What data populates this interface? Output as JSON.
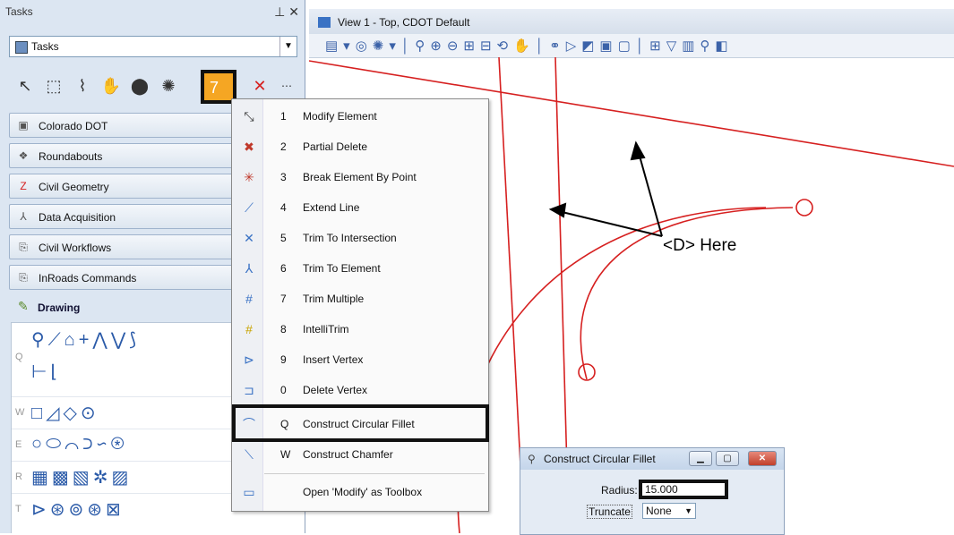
{
  "tasks_panel": {
    "title": "Tasks",
    "title_controls": "A ✕",
    "combo_value": "Tasks",
    "highlight_number": "7",
    "groups": [
      {
        "label": "Colorado DOT",
        "icon": "colorado-dot-icon"
      },
      {
        "label": "Roundabouts",
        "icon": "roundabout-icon"
      },
      {
        "label": "Civil Geometry",
        "icon": "civil-geometry-icon"
      },
      {
        "label": "Data Acquisition",
        "icon": "data-acquisition-icon"
      },
      {
        "label": "Civil Workflows",
        "icon": "workflow-icon"
      },
      {
        "label": "InRoads Commands",
        "icon": "inroads-icon"
      }
    ],
    "drawing_label": "Drawing",
    "palette_keys": [
      "Q",
      "W",
      "E",
      "R",
      "T"
    ]
  },
  "view": {
    "title": "View 1 - Top, CDOT Default",
    "annotation": "<D> Here"
  },
  "menu": {
    "items": [
      {
        "key": "1",
        "label": "Modify Element"
      },
      {
        "key": "2",
        "label": "Partial Delete"
      },
      {
        "key": "3",
        "label": "Break Element By Point"
      },
      {
        "key": "4",
        "label": "Extend Line"
      },
      {
        "key": "5",
        "label": "Trim To Intersection"
      },
      {
        "key": "6",
        "label": "Trim To Element"
      },
      {
        "key": "7",
        "label": "Trim Multiple"
      },
      {
        "key": "8",
        "label": "IntelliTrim"
      },
      {
        "key": "9",
        "label": "Insert Vertex"
      },
      {
        "key": "0",
        "label": "Delete Vertex"
      },
      {
        "key": "Q",
        "label": "Construct Circular Fillet"
      },
      {
        "key": "W",
        "label": "Construct Chamfer"
      }
    ],
    "footer": "Open 'Modify' as Toolbox"
  },
  "dialog": {
    "title": "Construct Circular Fillet",
    "radius_label": "Radius:",
    "radius_value": "15.000",
    "truncate_label": "Truncate",
    "truncate_value": "None"
  },
  "colors": {
    "accent_orange": "#f5a623",
    "geometry_red": "#d62020",
    "panel_bg": "#dce6f2"
  }
}
